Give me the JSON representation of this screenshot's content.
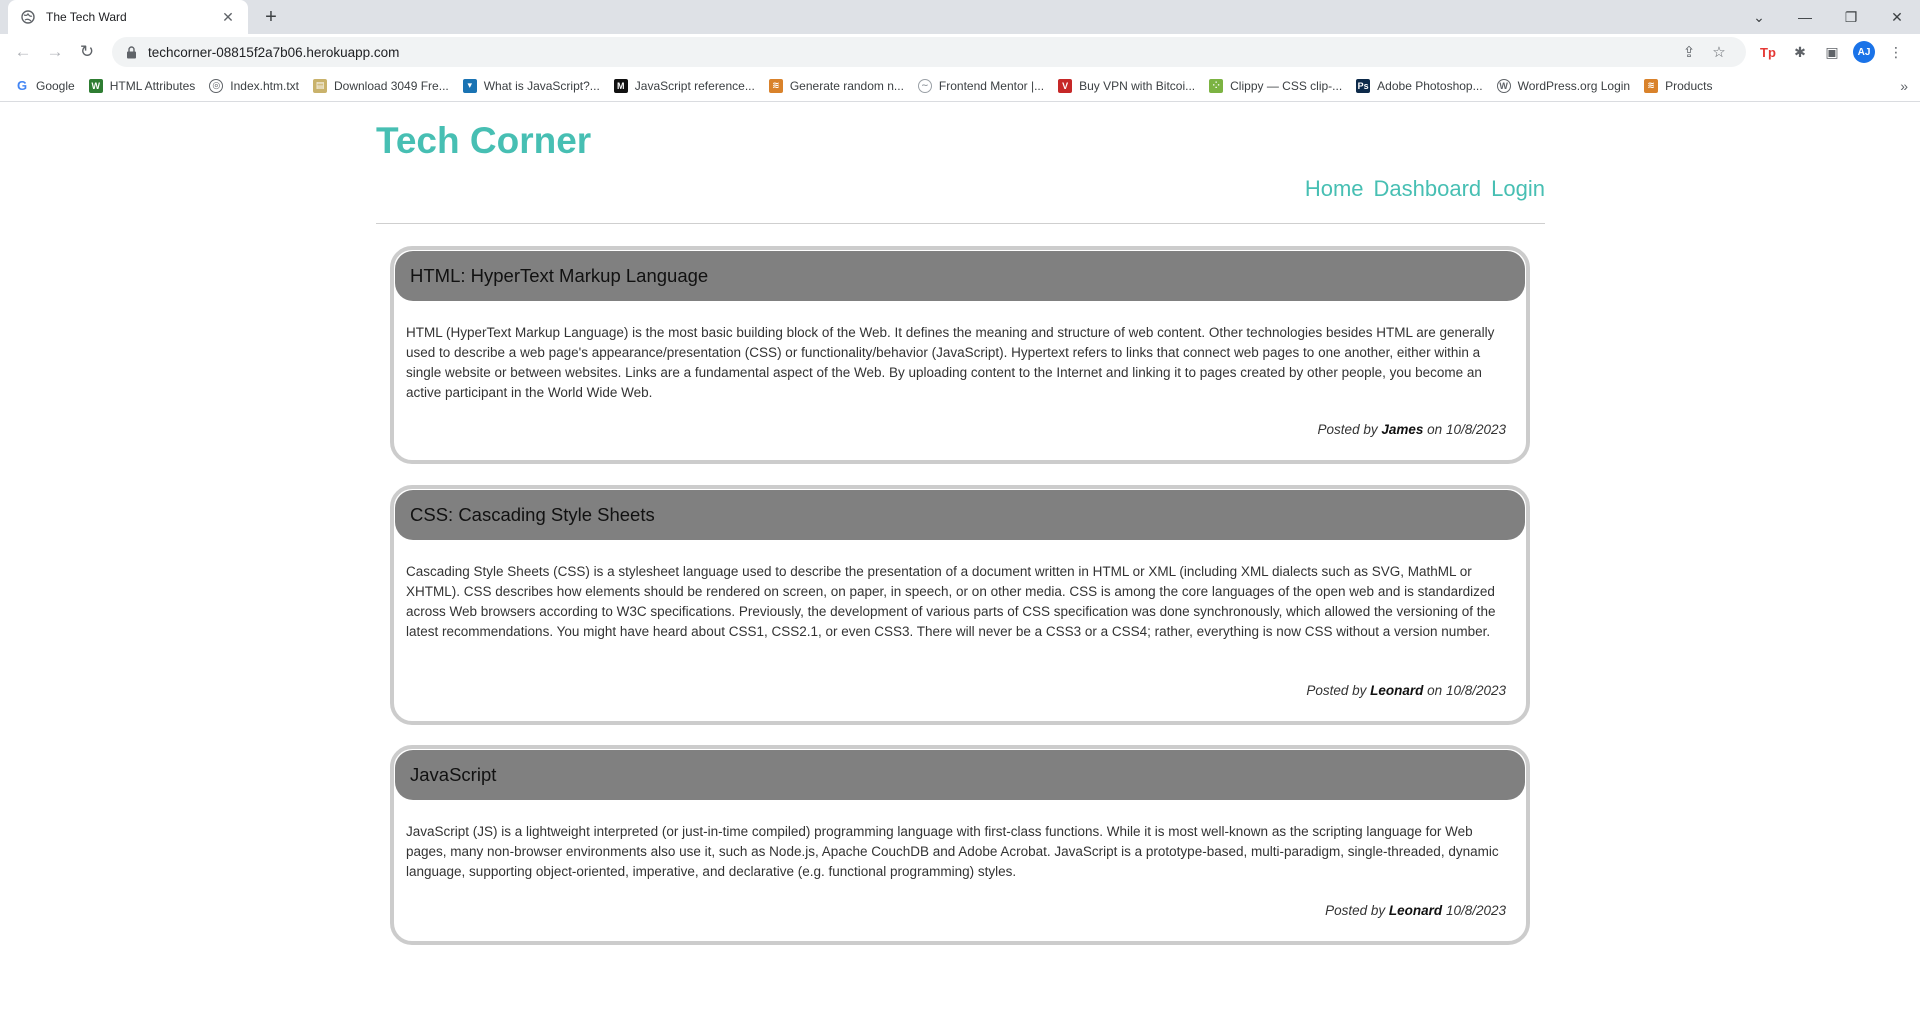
{
  "browser": {
    "tab_title": "The Tech Ward",
    "url": "techcorner-08815f2a7b06.herokuapp.com",
    "avatar_initials": "AJ",
    "bookmarks": [
      {
        "label": "Google",
        "icon": "google-icon",
        "color": "#4285f4"
      },
      {
        "label": "HTML Attributes",
        "icon": "w-icon",
        "color": "#2e7d32"
      },
      {
        "label": "Index.htm.txt",
        "icon": "globe-icon",
        "color": "#5f6368"
      },
      {
        "label": "Download 3049 Fre...",
        "icon": "folder-icon",
        "color": "#c9b26b"
      },
      {
        "label": "What is JavaScript?...",
        "icon": "mdn-icon",
        "color": "#1a73b3"
      },
      {
        "label": "JavaScript reference...",
        "icon": "m-icon",
        "color": "#111111"
      },
      {
        "label": "Generate random n...",
        "icon": "stack-icon",
        "color": "#d9822b"
      },
      {
        "label": "Frontend Mentor |...",
        "icon": "fm-icon",
        "color": "#9aa0a6"
      },
      {
        "label": "Buy VPN with Bitcoi...",
        "icon": "vpn-icon",
        "color": "#c62828"
      },
      {
        "label": "Clippy — CSS clip-...",
        "icon": "clippy-icon",
        "color": "#7cb342"
      },
      {
        "label": "Adobe Photoshop...",
        "icon": "ps-icon",
        "color": "#0d2a4a"
      },
      {
        "label": "WordPress.org Login",
        "icon": "wordpress-icon",
        "color": "#5f6368"
      },
      {
        "label": "Products",
        "icon": "stack-icon",
        "color": "#d9822b"
      }
    ]
  },
  "site": {
    "title": "Tech Corner",
    "nav": [
      "Home",
      "Dashboard",
      "Login"
    ],
    "accent": "#47bfb3"
  },
  "posts": [
    {
      "title": "HTML: HyperText Markup Language",
      "body": "HTML (HyperText Markup Language) is the most basic building block of the Web. It defines the meaning and structure of web content. Other technologies besides HTML are generally used to describe a web page's appearance/presentation (CSS) or functionality/behavior (JavaScript). Hypertext refers to links that connect web pages to one another, either within a single website or between websites. Links are a fundamental aspect of the Web. By uploading content to the Internet and linking it to pages created by other people, you become an active participant in the World Wide Web.",
      "posted_by_prefix": "Posted by",
      "author": "James",
      "on_text": "on 10/8/2023"
    },
    {
      "title": "CSS: Cascading Style Sheets",
      "body": "Cascading Style Sheets (CSS) is a stylesheet language used to describe the presentation of a document written in HTML or XML (including XML dialects such as SVG, MathML or XHTML). CSS describes how elements should be rendered on screen, on paper, in speech, or on other media. CSS is among the core languages of the open web and is standardized across Web browsers according to W3C specifications. Previously, the development of various parts of CSS specification was done synchronously, which allowed the versioning of the latest recommendations. You might have heard about CSS1, CSS2.1, or even CSS3. There will never be a CSS3 or a CSS4; rather, everything is now CSS without a version number.",
      "posted_by_prefix": "Posted by",
      "author": "Leonard",
      "on_text": "on 10/8/2023"
    },
    {
      "title": "JavaScript",
      "body": "JavaScript (JS) is a lightweight interpreted (or just-in-time compiled) programming language with first-class functions. While it is most well-known as the scripting language for Web pages, many non-browser environments also use it, such as Node.js, Apache CouchDB and Adobe Acrobat. JavaScript is a prototype-based, multi-paradigm, single-threaded, dynamic language, supporting object-oriented, imperative, and declarative (e.g. functional programming) styles.",
      "posted_by_prefix": "Posted by",
      "author": "Leonard",
      "on_text": "10/8/2023"
    }
  ]
}
